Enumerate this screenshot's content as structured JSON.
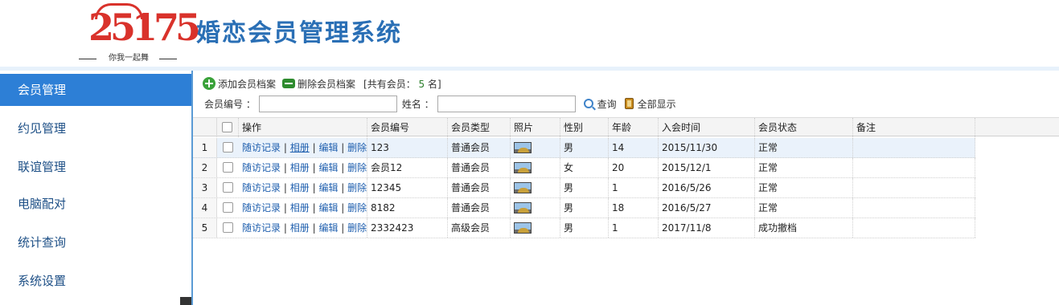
{
  "header": {
    "logo_number": "25175",
    "logo_tagline": "你我一起舞",
    "system_title": "婚恋会员管理系统"
  },
  "sidebar": {
    "items": [
      {
        "label": "会员管理",
        "active": true
      },
      {
        "label": "约见管理"
      },
      {
        "label": "联谊管理"
      },
      {
        "label": "电脑配对"
      },
      {
        "label": "统计查询"
      },
      {
        "label": "系统设置"
      }
    ]
  },
  "toolbar": {
    "add_label": "添加会员档案",
    "delete_label": "删除会员档案",
    "count_prefix": "[共有会员：",
    "count_value": "5",
    "count_suffix": "名]"
  },
  "search": {
    "member_no_label": "会员编号 ：",
    "name_label": "姓名 ：",
    "member_no_value": "",
    "name_value": "",
    "search_label": "查询",
    "show_all_label": "全部显示"
  },
  "table": {
    "headers": [
      "操作",
      "会员编号",
      "会员类型",
      "照片",
      "性别",
      "年龄",
      "入会时间",
      "会员状态",
      "备注"
    ],
    "op_links": [
      "随访记录",
      "相册",
      "编辑",
      "删除"
    ],
    "rows": [
      {
        "num": "1",
        "member_no": "123",
        "type": "普通会员",
        "gender": "男",
        "age": "14",
        "join_date": "2015/11/30",
        "status": "正常",
        "note": "",
        "selected": true
      },
      {
        "num": "2",
        "member_no": "会员12",
        "type": "普通会员",
        "gender": "女",
        "age": "20",
        "join_date": "2015/12/1",
        "status": "正常",
        "note": ""
      },
      {
        "num": "3",
        "member_no": "12345",
        "type": "普通会员",
        "gender": "男",
        "age": "1",
        "join_date": "2016/5/26",
        "status": "正常",
        "note": ""
      },
      {
        "num": "4",
        "member_no": "8182",
        "type": "普通会员",
        "gender": "男",
        "age": "18",
        "join_date": "2016/5/27",
        "status": "正常",
        "note": ""
      },
      {
        "num": "5",
        "member_no": "2332423",
        "type": "高级会员",
        "gender": "男",
        "age": "1",
        "join_date": "2017/11/8",
        "status": "成功撤档",
        "note": ""
      }
    ]
  },
  "colors": {
    "accent": "#2d7fd6",
    "title": "#2a6fb5",
    "logo_red": "#d9322b",
    "link": "#1f5fae"
  }
}
